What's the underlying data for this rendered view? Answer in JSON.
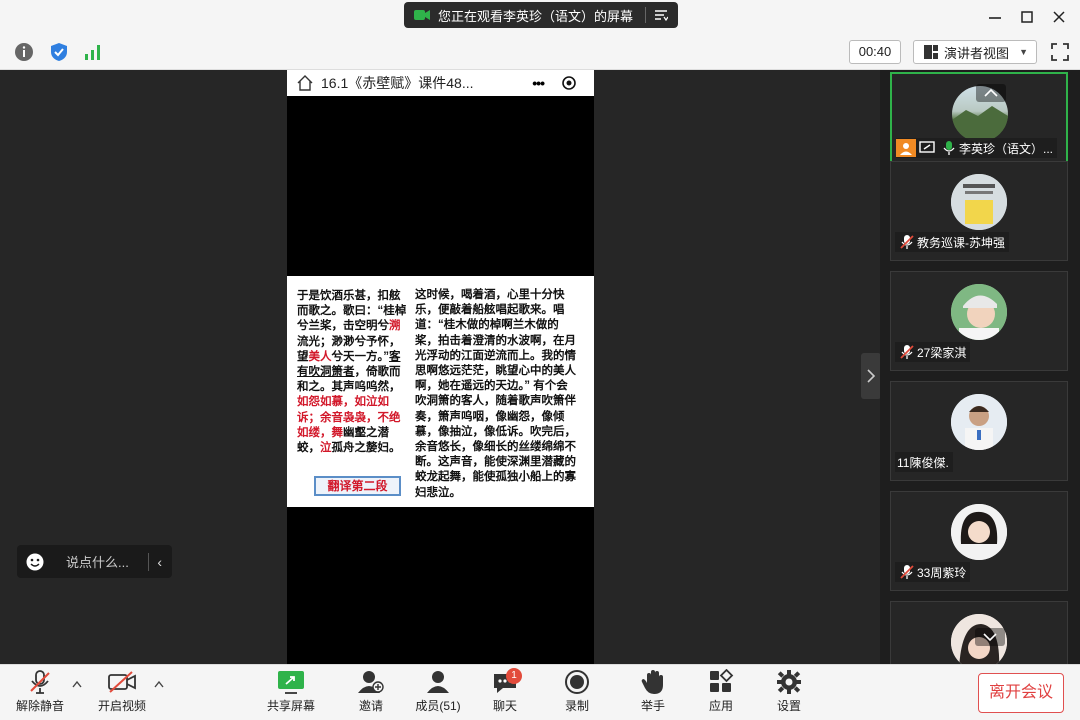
{
  "titlebar": {
    "share_text": "您正在观看李英珍（语文）的屏幕"
  },
  "toolbar": {
    "timer": "00:40",
    "view_label": "演讲者视图"
  },
  "slide": {
    "title": "16.1《赤壁赋》课件48...",
    "more": "•••",
    "left_text": {
      "p1": "于是饮酒乐甚，扣舷而歌之。歌曰：“桂棹兮兰桨，击空明兮",
      "p1_red": "溯",
      "p2": "流光；渺渺兮予怀，望",
      "p2_red": "美人",
      "p3": "兮天一方。”",
      "p3_ul": "客有吹洞箫者",
      "p4": "，倚歌而和之。其声呜呜然，",
      "p4_red": "如怨如慕，如泣如诉；余音袅袅，不绝如缕，舞",
      "p5": "幽壑之潜蛟，",
      "p5_red": "泣",
      "p6": "孤舟之嫠妇。"
    },
    "right_text": "这时候，喝着酒，心里十分快乐，便敲着船舷唱起歌来。唱道：“桂木做的棹啊兰木做的桨，拍击着澄清的水波啊，在月光浮动的江面逆流而上。我的情思啊悠远茫茫，眺望心中的美人啊，她在遥远的天边。” 有个会吹洞箫的客人，随着歌声吹箫伴奏，箫声呜咽，像幽怨，像倾慕，像抽泣，像低诉。吹完后，余音悠长，像细长的丝缕绵绵不断。这声音，能使深渊里潜藏的蛟龙起舞，能使孤独小船上的寡妇悲泣。",
    "translate_button": "翻译第二段"
  },
  "chat": {
    "placeholder": "说点什么..."
  },
  "participants": [
    {
      "name": "李英珍（语文）...",
      "active": true
    },
    {
      "name": "教务巡课-苏坤强",
      "active": false
    },
    {
      "name": "27梁家淇",
      "active": false
    },
    {
      "name": "11陳俊傑.",
      "active": false
    },
    {
      "name": "33周紫玲",
      "active": false
    },
    {
      "name": "",
      "active": false
    }
  ],
  "bottom": {
    "unmute": "解除静音",
    "video": "开启视频",
    "share": "共享屏幕",
    "invite": "邀请",
    "members": "成员(51)",
    "chat": "聊天",
    "chat_badge": "1",
    "record": "录制",
    "raise_hand": "举手",
    "apps": "应用",
    "settings": "设置",
    "leave": "离开会议"
  },
  "colors": {
    "accent_green": "#2fb34a",
    "leave_red": "#e04040",
    "slide_red": "#d2182a"
  }
}
